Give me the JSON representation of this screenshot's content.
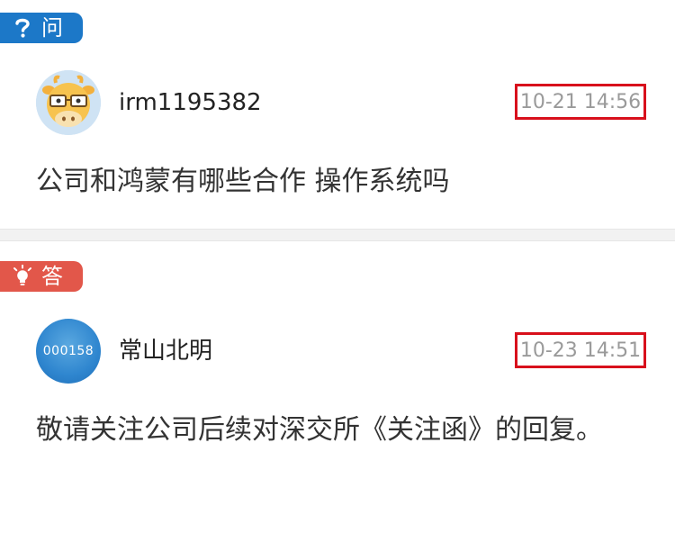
{
  "question": {
    "tag_label": "问",
    "tag_icon": "question-mark-icon",
    "username": "irm1195382",
    "timestamp": "10-21 14:56",
    "text": "公司和鸿蒙有哪些合作 操作系统吗"
  },
  "answer": {
    "tag_label": "答",
    "tag_icon": "lightbulb-icon",
    "avatar_text": "000158",
    "username": "常山北明",
    "timestamp": "10-23 14:51",
    "text": "敬请关注公司后续对深交所《关注函》的回复。"
  },
  "colors": {
    "question_tag": "#1c78c8",
    "answer_tag": "#e2574a",
    "timestamp_highlight": "#d8101c"
  }
}
